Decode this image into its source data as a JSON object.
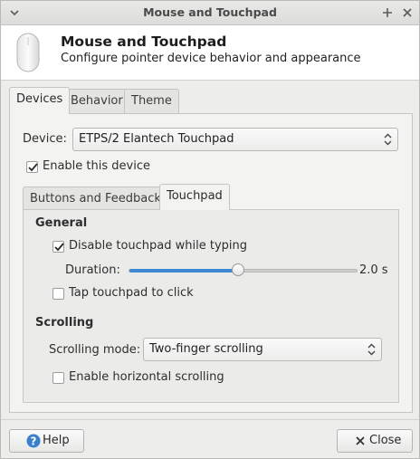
{
  "window": {
    "title": "Mouse and Touchpad"
  },
  "header": {
    "title": "Mouse and Touchpad",
    "subtitle": "Configure pointer device behavior and appearance",
    "icon": "mouse-icon"
  },
  "tabs": [
    {
      "label": "Devices",
      "active": true
    },
    {
      "label": "Behavior",
      "active": false
    },
    {
      "label": "Theme",
      "active": false
    }
  ],
  "devices": {
    "device_label": "Device:",
    "device_value": "ETPS/2 Elantech Touchpad",
    "enable_label": "Enable this device",
    "enable_checked": true,
    "subtabs": [
      {
        "label": "Buttons and Feedback",
        "active": false
      },
      {
        "label": "Touchpad",
        "active": true
      }
    ]
  },
  "touchpad": {
    "general_title": "General",
    "disable_typing_label": "Disable touchpad while typing",
    "disable_typing_checked": true,
    "duration_label": "Duration:",
    "duration_value": "2.0 s",
    "duration_fraction": 0.48,
    "tap_label": "Tap touchpad to click",
    "tap_checked": false,
    "scrolling_title": "Scrolling",
    "scrolling_mode_label": "Scrolling mode:",
    "scrolling_mode_value": "Two-finger scrolling",
    "horizontal_label": "Enable horizontal scrolling",
    "horizontal_checked": false
  },
  "footer": {
    "help_label": "Help",
    "close_label": "Close"
  },
  "colors": {
    "accent": "#3f88d3",
    "help_icon": "#3a7fcc"
  }
}
